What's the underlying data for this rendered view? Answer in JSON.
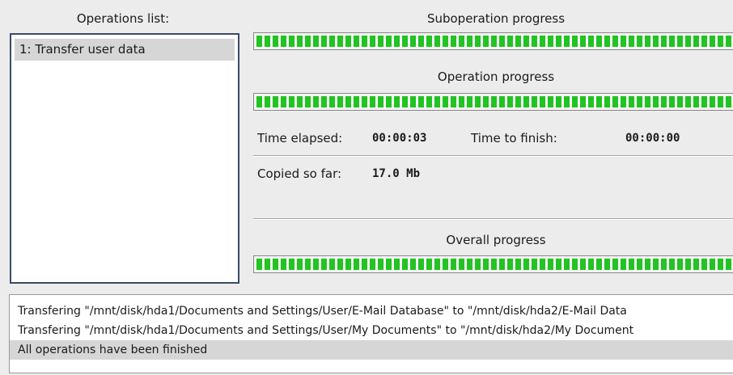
{
  "operations": {
    "title": "Operations list:",
    "items": [
      {
        "label": "1: Transfer user data"
      }
    ]
  },
  "suboperation": {
    "label": "Suboperation progress",
    "progress": 1.0
  },
  "operation": {
    "label": "Operation progress",
    "progress": 1.0
  },
  "stats": {
    "time_elapsed_label": "Time elapsed:",
    "time_elapsed": "00:00:03",
    "time_to_finish_label": "Time to finish:",
    "time_to_finish": "00:00:00",
    "copied_label": "Copied so far:",
    "copied": "17.0 Mb"
  },
  "overall": {
    "label": "Overall progress",
    "progress": 1.0
  },
  "log": [
    "Transfering \"/mnt/disk/hda1/Documents and Settings/User/E-Mail Database\" to \"/mnt/disk/hda2/E-Mail Data",
    "Transfering \"/mnt/disk/hda1/Documents and Settings/User/My Documents\" to \"/mnt/disk/hda2/My Document",
    "All operations have been finished"
  ],
  "colors": {
    "progress_fill": "#22c322",
    "selection": "#d6d6d6",
    "list_border": "#3b4a68"
  }
}
